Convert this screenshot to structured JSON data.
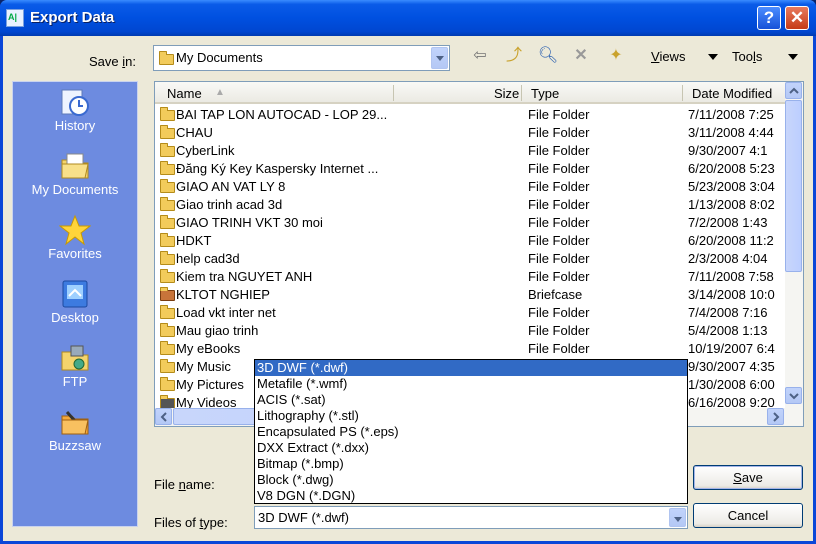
{
  "window": {
    "title": "Export Data",
    "help_label": "?",
    "close_label": "✕"
  },
  "save_in": {
    "label_pre": "Save ",
    "label_acc": "i",
    "label_post": "n:",
    "value": "My Documents"
  },
  "toolbar": {
    "views_pre": "",
    "views_acc": "V",
    "views_post": "iews",
    "tools_pre": "Too",
    "tools_acc": "l",
    "tools_post": "s"
  },
  "places": [
    {
      "label": "History",
      "icon": "history-icon"
    },
    {
      "label": "My Documents",
      "icon": "my-documents-icon"
    },
    {
      "label": "Favorites",
      "icon": "favorites-star-icon"
    },
    {
      "label": "Desktop",
      "icon": "desktop-icon"
    },
    {
      "label": "FTP",
      "icon": "ftp-icon"
    },
    {
      "label": "Buzzsaw",
      "icon": "buzzsaw-icon"
    }
  ],
  "columns": {
    "name": "Name",
    "size": "Size",
    "type": "Type",
    "date": "Date Modified"
  },
  "files": [
    {
      "name": "BAI TAP LON AUTOCAD - LOP 29...",
      "type": "File Folder",
      "date": "7/11/2008 7:25",
      "icon": "folder-icon"
    },
    {
      "name": "CHAU",
      "type": "File Folder",
      "date": "3/11/2008 4:44",
      "icon": "folder-icon"
    },
    {
      "name": "CyberLink",
      "type": "File Folder",
      "date": "9/30/2007 4:1",
      "icon": "folder-icon"
    },
    {
      "name": "Đăng Ký Key Kaspersky Internet ...",
      "type": "File Folder",
      "date": "6/20/2008 5:23",
      "icon": "folder-icon"
    },
    {
      "name": "GIAO AN VAT LY 8",
      "type": "File Folder",
      "date": "5/23/2008 3:04",
      "icon": "folder-icon"
    },
    {
      "name": "Giao trinh acad 3d",
      "type": "File Folder",
      "date": "1/13/2008 8:02",
      "icon": "folder-icon"
    },
    {
      "name": "GIAO TRINH VKT 30 moi",
      "type": "File Folder",
      "date": "7/2/2008 1:43",
      "icon": "folder-icon"
    },
    {
      "name": "HDKT",
      "type": "File Folder",
      "date": "6/20/2008 11:2",
      "icon": "folder-icon"
    },
    {
      "name": "help cad3d",
      "type": "File Folder",
      "date": "2/3/2008 4:04",
      "icon": "folder-icon"
    },
    {
      "name": "Kiem tra NGUYET ANH",
      "type": "File Folder",
      "date": "7/11/2008 7:58",
      "icon": "folder-icon"
    },
    {
      "name": "KLTOT NGHIEP",
      "type": "Briefcase",
      "date": "3/14/2008 10:0",
      "icon": "briefcase-icon"
    },
    {
      "name": "Load vkt inter net",
      "type": "File Folder",
      "date": "7/4/2008 7:16",
      "icon": "folder-icon"
    },
    {
      "name": "Mau giao trinh",
      "type": "File Folder",
      "date": "5/4/2008 1:13",
      "icon": "folder-icon"
    },
    {
      "name": "My eBooks",
      "type": "File Folder",
      "date": "10/19/2007 6:4",
      "icon": "folder-icon"
    },
    {
      "name": "My Music",
      "type": "",
      "date": "9/30/2007 4:35",
      "icon": "music-folder-icon"
    },
    {
      "name": "My Pictures",
      "type": "",
      "date": "1/30/2008 6:00",
      "icon": "pictures-folder-icon"
    },
    {
      "name": "My Videos",
      "type": "",
      "date": "6/16/2008 9:20",
      "icon": "videos-folder-icon"
    }
  ],
  "file_name": {
    "label_pre": "File ",
    "label_acc": "n",
    "label_post": "ame:",
    "value": ""
  },
  "file_type": {
    "label_pre": "Files of ",
    "label_acc": "t",
    "label_post": "ype:",
    "value": "3D DWF (*.dwf)",
    "options": [
      "3D DWF (*.dwf)",
      "Metafile (*.wmf)",
      "ACIS (*.sat)",
      "Lithography (*.stl)",
      "Encapsulated PS (*.eps)",
      "DXX Extract (*.dxx)",
      "Bitmap (*.bmp)",
      "Block (*.dwg)",
      "V8 DGN (*.DGN)"
    ]
  },
  "buttons": {
    "save_pre": "",
    "save_acc": "S",
    "save_post": "ave",
    "cancel": "Cancel"
  },
  "colors": {
    "title_bar": "#0050e0",
    "places_bar": "#6d8be0",
    "selection": "#316ac5",
    "dialog_bg": "#ece9d8"
  }
}
